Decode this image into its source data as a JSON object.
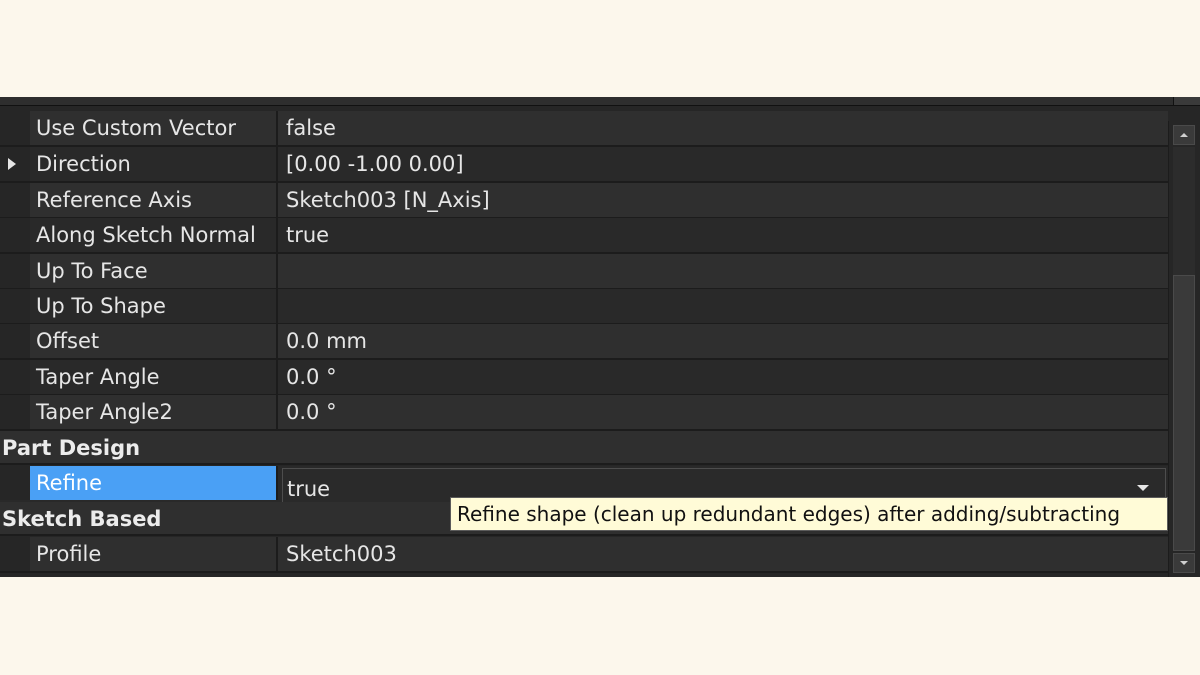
{
  "properties": [
    {
      "name": "Use Custom Vector",
      "value": "false"
    },
    {
      "name": "Direction",
      "value": "[0.00 -1.00 0.00]"
    },
    {
      "name": "Reference Axis",
      "value": "Sketch003 [N_Axis]"
    },
    {
      "name": "Along Sketch Normal",
      "value": "true"
    },
    {
      "name": "Up To Face",
      "value": ""
    },
    {
      "name": "Up To Shape",
      "value": ""
    },
    {
      "name": "Offset",
      "value": "0.0 mm"
    },
    {
      "name": "Taper Angle",
      "value": "0.0 °"
    },
    {
      "name": "Taper Angle2",
      "value": "0.0 °"
    }
  ],
  "groups": {
    "part_design": "Part Design",
    "sketch_based": "Sketch Based"
  },
  "refine": {
    "name": "Refine",
    "value": "true"
  },
  "profile": {
    "name": "Profile",
    "value": "Sketch003"
  },
  "tooltip": "Refine shape (clean up redundant edges) after adding/subtracting",
  "colors": {
    "selection": "#4aa0f5",
    "panel": "#262626",
    "tooltip_bg": "#fffbd7"
  }
}
